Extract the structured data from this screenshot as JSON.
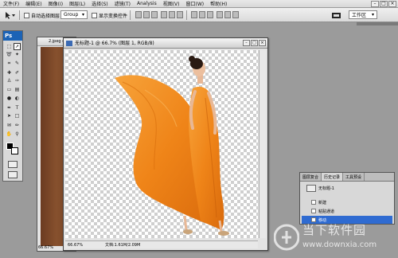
{
  "menu": {
    "items": [
      "文件(F)",
      "编辑(E)",
      "图像(I)",
      "图层(L)",
      "选择(S)",
      "滤镜(T)",
      "Analysis",
      "视图(V)",
      "窗口(W)",
      "帮助(H)"
    ]
  },
  "window_controls": {
    "minimize": "–",
    "maximize": "□",
    "close": "×"
  },
  "options_bar": {
    "auto_select_label": "自动选择图层",
    "group_value": "Group",
    "show_transform_label": "显示变换控件",
    "workspace_label": "工作区"
  },
  "toolbox": {
    "logo": "Ps"
  },
  "doc_back": {
    "title": "2.jpeg @",
    "zoom": "66.67%"
  },
  "doc_main": {
    "title": "无标题-1 @ 66.7% (图层 1, RGB/8)",
    "zoom": "66.67%",
    "doc_size": "文档:1.61M/2.09M"
  },
  "history_panel": {
    "tabs": [
      "图层复合",
      "历史记录",
      "工具预设"
    ],
    "snapshot": "无标题-1",
    "entries": [
      "新建",
      "粘贴通道",
      "移动"
    ],
    "selected_index": 2
  },
  "watermark": {
    "title": "当下软件园",
    "url": "www.downxia.com"
  },
  "colors": {
    "dress": "#f08a1c",
    "ps_blue": "#1b63b6",
    "selection": "#2f6bd1"
  }
}
